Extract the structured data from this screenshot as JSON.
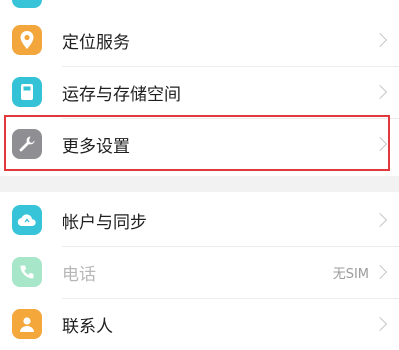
{
  "settings": {
    "items": [
      {
        "label": "定位服务",
        "icon": "location-pin-icon",
        "color": "#f3a63b"
      },
      {
        "label": "运存与存储空间",
        "icon": "storage-icon",
        "color": "#34c3d6"
      },
      {
        "label": "更多设置",
        "icon": "wrench-icon",
        "color": "#8e8e93"
      },
      {
        "label": "帐户与同步",
        "icon": "cloud-sync-icon",
        "color": "#37c4d8"
      },
      {
        "label": "电话",
        "icon": "phone-icon",
        "color": "#a8e6c9",
        "value": "无SIM"
      },
      {
        "label": "联系人",
        "icon": "contact-icon",
        "color": "#f4a73a"
      }
    ]
  },
  "colors": {
    "highlight": "#e0383c"
  }
}
